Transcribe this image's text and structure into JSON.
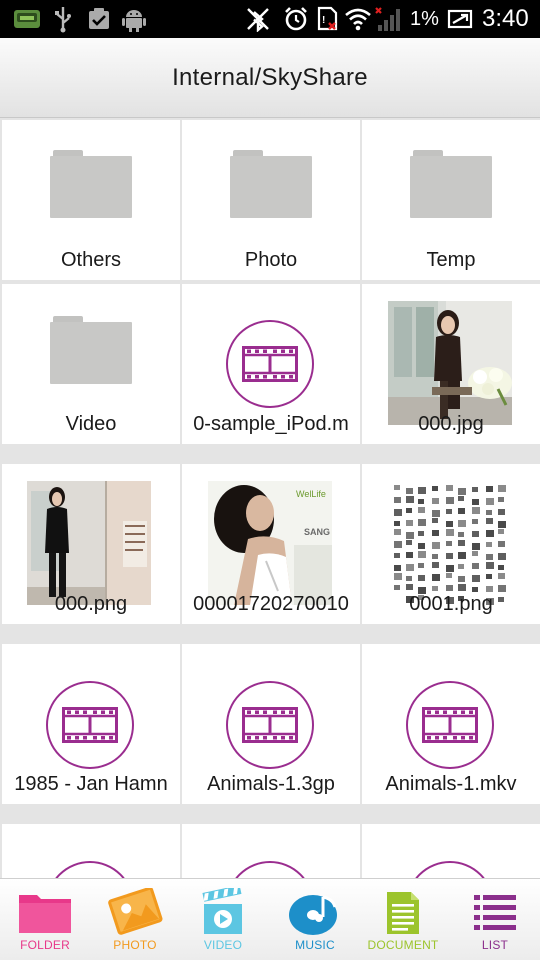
{
  "status_bar": {
    "battery_percent": "1%",
    "time": "3:40",
    "icons": [
      "sd-card-icon",
      "usb-icon",
      "clipboard-check-icon",
      "android-icon",
      "bluetooth-off-icon",
      "alarm-icon",
      "sim-error-icon",
      "wifi-icon",
      "signal-icon",
      "battery-charging-icon"
    ]
  },
  "header": {
    "title": "Internal/SkyShare"
  },
  "items": [
    {
      "label": "Others",
      "kind": "folder"
    },
    {
      "label": "Photo",
      "kind": "folder"
    },
    {
      "label": "Temp",
      "kind": "folder"
    },
    {
      "label": "Video",
      "kind": "folder"
    },
    {
      "label": "0-sample_iPod.m",
      "kind": "video"
    },
    {
      "label": "000.jpg",
      "kind": "image"
    },
    {
      "label": "000.png",
      "kind": "image"
    },
    {
      "label": "00001720270010",
      "kind": "image"
    },
    {
      "label": "0001.png",
      "kind": "image"
    },
    {
      "label": "1985 - Jan Hamn",
      "kind": "video"
    },
    {
      "label": "Animals-1.3gp",
      "kind": "video"
    },
    {
      "label": "Animals-1.mkv",
      "kind": "video"
    },
    {
      "label": "",
      "kind": "video"
    },
    {
      "label": "",
      "kind": "video"
    },
    {
      "label": "",
      "kind": "video"
    }
  ],
  "thumbnail_text": {
    "wellife": "WelLife",
    "sang": "SANG"
  },
  "bottom_nav": [
    {
      "label": "FOLDER",
      "icon": "folder-icon",
      "color": "#e8388a"
    },
    {
      "label": "PHOTO",
      "icon": "photo-icon",
      "color": "#f29a1e"
    },
    {
      "label": "VIDEO",
      "icon": "video-icon",
      "color": "#5cc6e2"
    },
    {
      "label": "MUSIC",
      "icon": "music-icon",
      "color": "#1d8fc9"
    },
    {
      "label": "DOCUMENT",
      "icon": "document-icon",
      "color": "#9cc42c"
    },
    {
      "label": "LIST",
      "icon": "list-icon",
      "color": "#8b2f8c"
    }
  ],
  "colors": {
    "accent_video": "#9a2d8f",
    "folder_gray": "#c8c8c6",
    "status_bar_bg": "#000000",
    "alert_red": "#e02020"
  }
}
